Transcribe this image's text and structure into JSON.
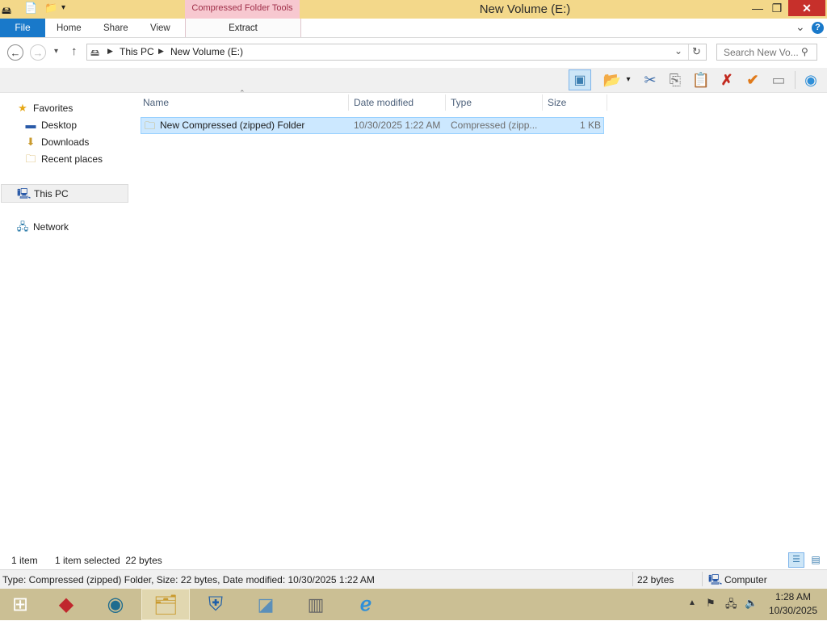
{
  "window": {
    "title": "New Volume (E:)",
    "context_group": "Compressed Folder Tools",
    "minimize": "—",
    "restore": "❐",
    "close": "✕"
  },
  "ribbon": {
    "file": "File",
    "tabs": [
      "Home",
      "Share",
      "View"
    ],
    "extract": "Extract",
    "collapse": "⌄",
    "help": "?"
  },
  "address": {
    "segments": [
      "This PC",
      "New Volume (E:)"
    ],
    "search_placeholder": "Search New Vo..."
  },
  "sidebar": {
    "favorites": "Favorites",
    "favorites_items": [
      "Desktop",
      "Downloads",
      "Recent places"
    ],
    "this_pc": "This PC",
    "network": "Network"
  },
  "columns": [
    "Name",
    "Date modified",
    "Type",
    "Size"
  ],
  "files": [
    {
      "name": "New Compressed (zipped) Folder",
      "date": "10/30/2025 1:22 AM",
      "type": "Compressed (zipp...",
      "size": "1 KB"
    }
  ],
  "status": {
    "count": "1 item",
    "selected": "1 item selected  22 bytes",
    "details": "Type: Compressed (zipped) Folder, Size: 22 bytes, Date modified: 10/30/2025 1:22 AM",
    "size": "22 bytes",
    "location": "Computer"
  },
  "clock": {
    "time": "1:28 AM",
    "date": "10/30/2025"
  },
  "icons": {
    "back": "arrow-left-icon",
    "forward": "arrow-right-icon",
    "up": "arrow-up-icon",
    "refresh": "refresh-icon",
    "search": "search-icon",
    "cut": "scissors-icon",
    "copy": "copy-icon",
    "paste": "paste-icon",
    "delete": "delete-x-icon",
    "check": "checkmark-icon"
  },
  "colors": {
    "title_bar": "#f3d88a",
    "context_tab": "#f7c8d0",
    "file_tab": "#1979ca",
    "selection": "#cce8ff",
    "close": "#c7302b",
    "taskbar": "#cbbf94"
  }
}
